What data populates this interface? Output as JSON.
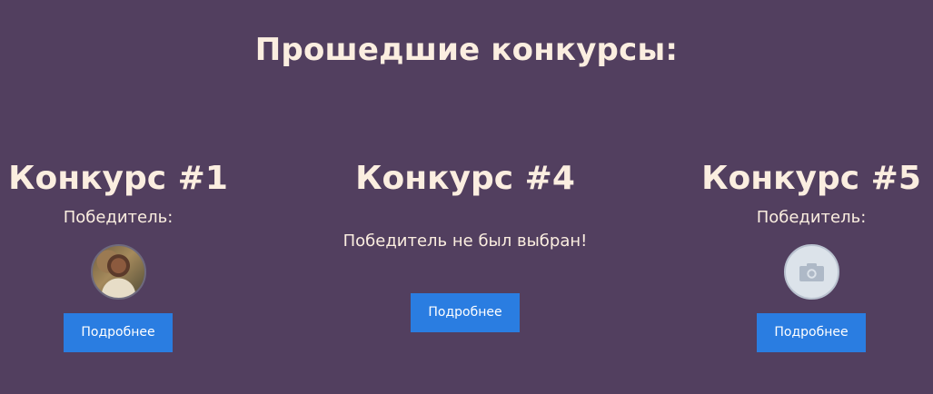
{
  "page": {
    "title": "Прошедшие конкурсы:"
  },
  "contests": [
    {
      "title": "Конкурс #1",
      "winner_label": "Победитель:",
      "avatar": "winner-photo",
      "button_label": "Подробнее"
    },
    {
      "title": "Конкурс #4",
      "status_text": "Победитель не был выбран!",
      "button_label": "Подробнее"
    },
    {
      "title": "Конкурс #5",
      "winner_label": "Победитель:",
      "avatar": "camera-icon",
      "button_label": "Подробнее"
    }
  ],
  "colors": {
    "background": "#523f5f",
    "text": "#fbeee0",
    "button": "#2a7de1",
    "placeholder": "#dce3ea"
  }
}
